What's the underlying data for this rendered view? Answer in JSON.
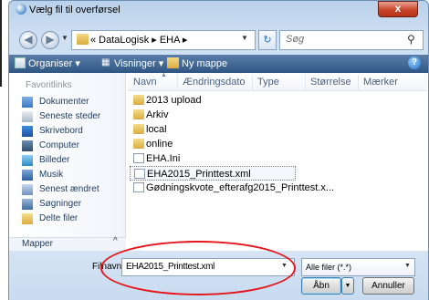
{
  "window": {
    "title": "Vælg fil til overførsel",
    "close_label": "x",
    "accent": "#c9452b"
  },
  "nav": {
    "back_icon": "◀",
    "forward_icon": "▶",
    "breadcrumb": "« DataLogisk  ▸  EHA  ▸",
    "dropdown_icon": "▼",
    "refresh_icon": "↻",
    "search_placeholder": "Søg",
    "search_icon": "⚲"
  },
  "toolbar": {
    "organize_label": "Organiser ▾",
    "views_label": "Visninger ▾",
    "new_folder_label": "Ny mappe",
    "help_label": "?"
  },
  "sidebar": {
    "header": "Favoritlinks",
    "items": [
      {
        "label": "Dokumenter",
        "icon": "documents-icon"
      },
      {
        "label": "Seneste steder",
        "icon": "recent-places-icon"
      },
      {
        "label": "Skrivebord",
        "icon": "desktop-icon"
      },
      {
        "label": "Computer",
        "icon": "computer-icon"
      },
      {
        "label": "Billeder",
        "icon": "pictures-icon"
      },
      {
        "label": "Musik",
        "icon": "music-icon"
      },
      {
        "label": "Senest ændret",
        "icon": "recently-changed-icon"
      },
      {
        "label": "Søgninger",
        "icon": "searches-icon"
      },
      {
        "label": "Delte filer",
        "icon": "shared-files-icon"
      }
    ],
    "folders_label": "Mapper",
    "folders_toggle": "^"
  },
  "columns": {
    "name": "Navn",
    "date": "Ændringsdato",
    "type": "Type",
    "size": "Størrelse",
    "tags": "Mærker"
  },
  "files": [
    {
      "name": "2013 upload",
      "kind": "folder"
    },
    {
      "name": "Arkiv",
      "kind": "folder"
    },
    {
      "name": "local",
      "kind": "folder"
    },
    {
      "name": "online",
      "kind": "folder"
    },
    {
      "name": "EHA.Ini",
      "kind": "file"
    },
    {
      "name": "EHA2015_Printtest.xml",
      "kind": "file"
    },
    {
      "name": "Gødningskvote_efterafg2015_Printtest.x...",
      "kind": "file"
    }
  ],
  "footer": {
    "filename_label": "Filnavn:",
    "filename_value": "EHA2015_Printtest.xml",
    "filter_value": "Alle filer (*.*)",
    "open_label": "Åbn",
    "open_drop": "▼",
    "cancel_label": "Annuller",
    "highlight_color": "#e4161b"
  }
}
